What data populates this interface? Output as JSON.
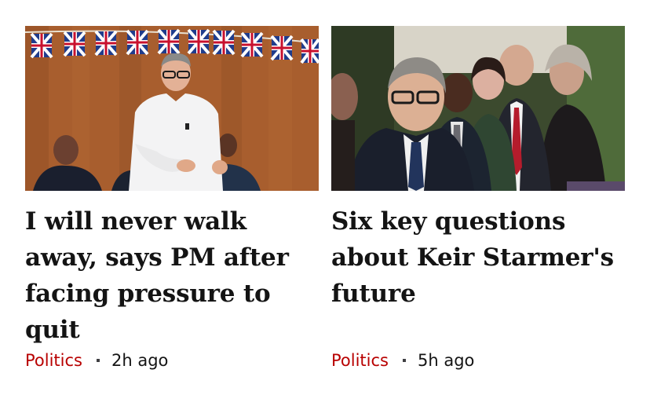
{
  "colors": {
    "topic_link": "#b80000",
    "headline": "#141414",
    "background": "#ffffff"
  },
  "cards": [
    {
      "image_alt": "Keir Starmer speaking in front of Union Jack bunting",
      "headline": "I will never walk away, says PM after facing pressure to quit",
      "topic": "Politics",
      "time": "2h ago"
    },
    {
      "image_alt": "Keir Starmer seated with cabinet colleagues",
      "headline": "Six key questions about Keir Starmer's future",
      "topic": "Politics",
      "time": "5h ago"
    }
  ]
}
